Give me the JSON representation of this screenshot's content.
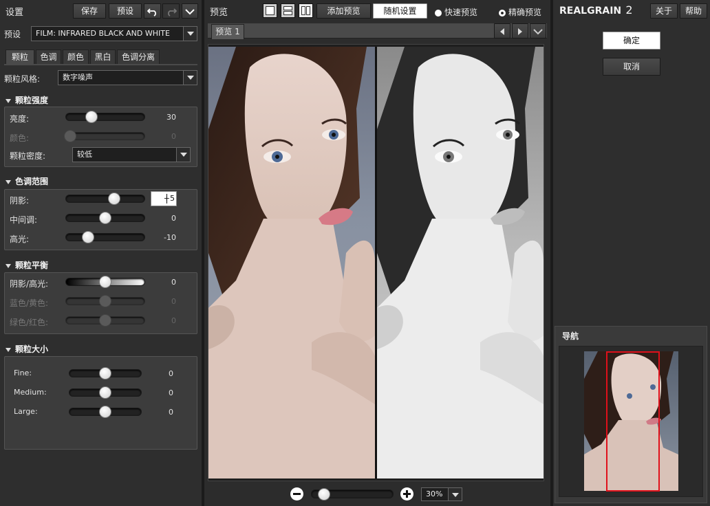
{
  "app": {
    "name_prefix": "REALGRAIN",
    "name_suffix": "2"
  },
  "left": {
    "title": "设置",
    "save_label": "保存",
    "preset_label": "预设",
    "undo_icon": "undo-icon",
    "redo_icon": "redo-icon",
    "preset_row_label": "预设",
    "preset_value": "FILM: INFRARED BLACK AND WHITE",
    "tabs": [
      "颗粒",
      "色调",
      "颜色",
      "黑白",
      "色调分离"
    ],
    "grain_style_label": "颗粒风格:",
    "grain_style_value": "数字噪声",
    "sections": {
      "strength": {
        "title": "颗粒强度",
        "brightness_label": "亮度:",
        "brightness_value": "30",
        "brightness_level": 30,
        "color_label": "颜色:",
        "color_value": "0",
        "color_level": 0,
        "density_label": "颗粒密度:",
        "density_value": "较低"
      },
      "tonal": {
        "title": "色调范围",
        "shadows_label": "阴影:",
        "shadows_value": "+5",
        "shadows_level": 5,
        "midtones_label": "中间调:",
        "midtones_value": "0",
        "midtones_level": 0,
        "highlights_label": "高光:",
        "highlights_value": "-10",
        "highlights_level": -10
      },
      "balance": {
        "title": "颗粒平衡",
        "sh_label": "阴影/高光:",
        "sh_value": "0",
        "by_label": "蓝色/黄色:",
        "by_value": "0",
        "gr_label": "绿色/红色:",
        "gr_value": "0"
      },
      "size": {
        "title": "颗粒大小",
        "fine_label": "Fine:",
        "fine_value": "0",
        "medium_label": "Medium:",
        "medium_value": "0",
        "large_label": "Large:",
        "large_value": "0"
      }
    }
  },
  "middle": {
    "title": "预览",
    "add_preview": "添加预览",
    "random_settings": "随机设置",
    "fast_preview": "快速预览",
    "accurate_preview": "精确预览",
    "tab_label": "预览 1",
    "zoom_value": "30%"
  },
  "right": {
    "about": "关于",
    "help": "帮助",
    "ok": "确定",
    "cancel": "取消",
    "navigator_title": "导航"
  },
  "colors": {
    "accent_red": "#e0101a",
    "panel": "#2f2f2f",
    "section": "#3c3c3c"
  }
}
